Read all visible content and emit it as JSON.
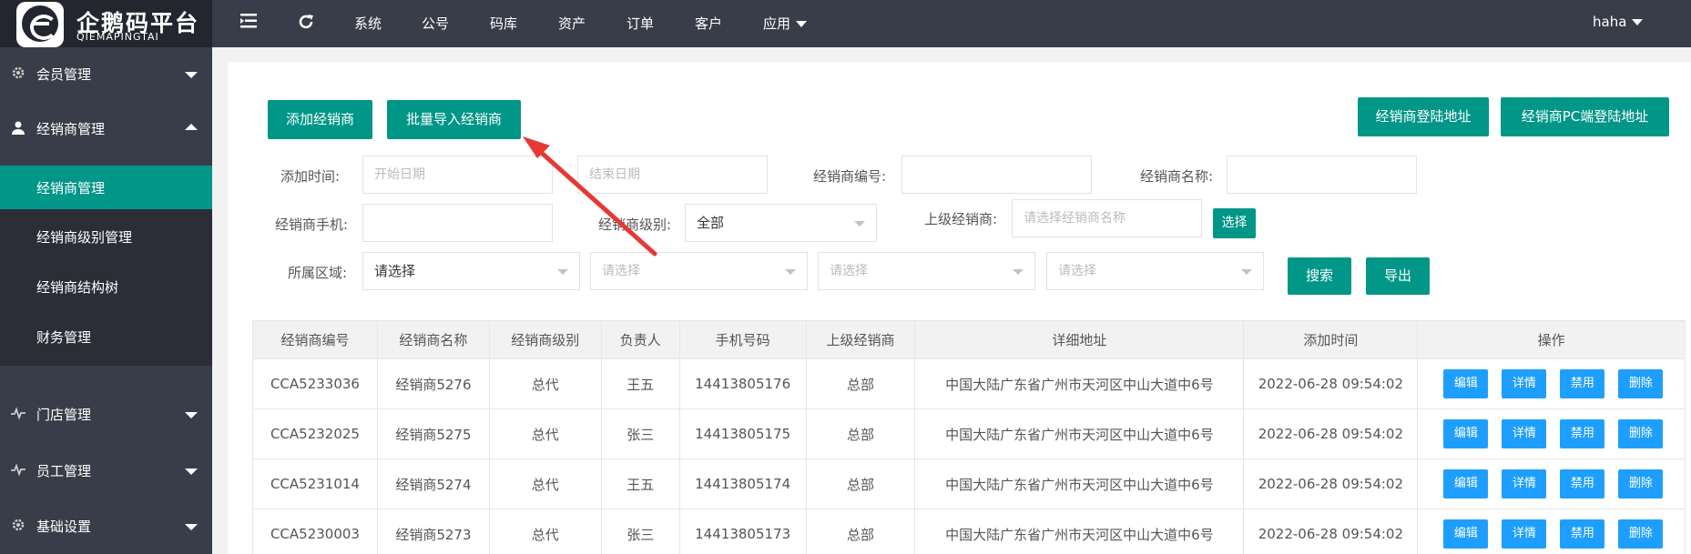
{
  "app": {
    "title": "企鹅码平台",
    "subtitle": "QIEMAPINGTAI"
  },
  "topnav": {
    "items": [
      "系统",
      "公号",
      "码库",
      "资产",
      "订单",
      "客户",
      "应用"
    ],
    "user": "haha"
  },
  "sidebar": {
    "items": [
      {
        "label": "会员管理",
        "icon": "gear-icon"
      },
      {
        "label": "经销商管理",
        "icon": "user-icon"
      },
      {
        "label": "门店管理",
        "icon": "pulse-icon"
      },
      {
        "label": "员工管理",
        "icon": "pulse-icon"
      },
      {
        "label": "基础设置",
        "icon": "gear-icon"
      }
    ],
    "subitems": [
      "经销商管理",
      "经销商级别管理",
      "经销商结构树",
      "财务管理"
    ]
  },
  "toolbar": {
    "add": "添加经销商",
    "import": "批量导入经销商",
    "login_url": "经销商登陆地址",
    "pc_login_url": "经销商PC端登陆地址"
  },
  "filters": {
    "added_time_label": "添加时间:",
    "start_date_placeholder": "开始日期",
    "end_date_placeholder": "结束日期",
    "dealer_no_label": "经销商编号:",
    "dealer_name_label": "经销商名称:",
    "dealer_phone_label": "经销商手机:",
    "dealer_level_label": "经销商级别:",
    "dealer_level_value": "全部",
    "parent_dealer_label": "上级经销商:",
    "parent_dealer_placeholder": "请选择经销商名称",
    "choose": "选择",
    "region_label": "所属区域:",
    "region_value": "请选择",
    "region_placeholder": "请选择",
    "search": "搜索",
    "export": "导出"
  },
  "table": {
    "headers": [
      "经销商编号",
      "经销商名称",
      "经销商级别",
      "负责人",
      "手机号码",
      "上级经销商",
      "详细地址",
      "添加时间",
      "操作"
    ],
    "rows": [
      [
        "CCA5233036",
        "经销商5276",
        "总代",
        "王五",
        "14413805176",
        "总部",
        "中国大陆广东省广州市天河区中山大道中6号",
        "2022-06-28 09:54:02"
      ],
      [
        "CCA5232025",
        "经销商5275",
        "总代",
        "张三",
        "14413805175",
        "总部",
        "中国大陆广东省广州市天河区中山大道中6号",
        "2022-06-28 09:54:02"
      ],
      [
        "CCA5231014",
        "经销商5274",
        "总代",
        "王五",
        "14413805174",
        "总部",
        "中国大陆广东省广州市天河区中山大道中6号",
        "2022-06-28 09:54:02"
      ],
      [
        "CCA5230003",
        "经销商5273",
        "总代",
        "张三",
        "14413805173",
        "总部",
        "中国大陆广东省广州市天河区中山大道中6号",
        "2022-06-28 09:54:02"
      ]
    ],
    "actions": [
      "编辑",
      "详情",
      "禁用",
      "删除"
    ]
  },
  "colors": {
    "primary": "#009688",
    "action": "#1e9fff",
    "nav": "#393d49",
    "annotation": "#e53935"
  }
}
